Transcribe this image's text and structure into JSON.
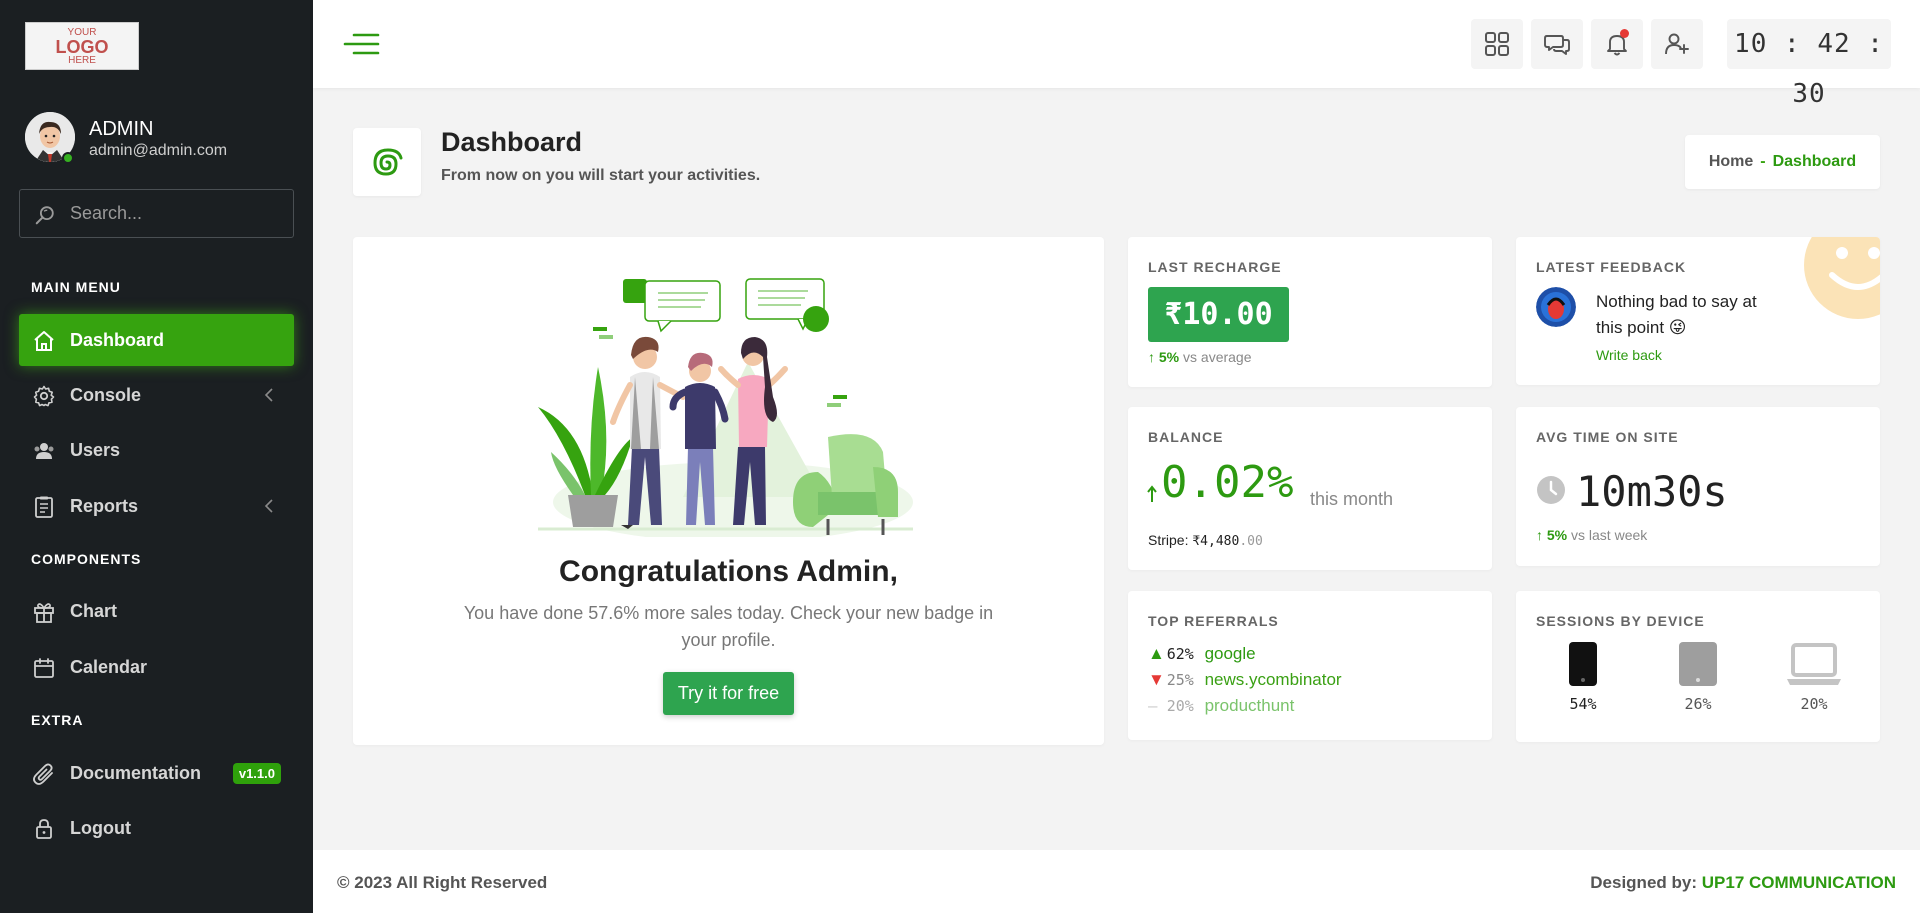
{
  "sidebar": {
    "logo": {
      "line1": "YOUR",
      "line2": "LOGO",
      "line3": "HERE"
    },
    "profile": {
      "name": "ADMIN",
      "email": "admin@admin.com",
      "status_color": "#36b021"
    },
    "search": {
      "placeholder": "Search..."
    },
    "sections": {
      "main": "MAIN MENU",
      "components": "COMPONENTS",
      "extra": "EXTRA"
    },
    "items": [
      {
        "label": "Dashboard",
        "icon": "home-icon",
        "active": true
      },
      {
        "label": "Console",
        "icon": "gear-icon",
        "has_submenu": true
      },
      {
        "label": "Users",
        "icon": "users-icon"
      },
      {
        "label": "Reports",
        "icon": "report-icon",
        "has_submenu": true
      },
      {
        "label": "Chart",
        "icon": "gift-icon"
      },
      {
        "label": "Calendar",
        "icon": "calendar-icon"
      },
      {
        "label": "Documentation",
        "icon": "paperclip-icon",
        "badge": "v1.1.0"
      },
      {
        "label": "Logout",
        "icon": "lock-icon"
      }
    ]
  },
  "header": {
    "buttons": [
      "grid-icon",
      "chat-icon",
      "bell-icon",
      "add-user-icon"
    ],
    "clock": "10 : 42 : 30"
  },
  "page": {
    "title": "Dashboard",
    "subtitle": "From now on you will start your activities.",
    "breadcrumb": {
      "home": "Home",
      "separator": "-",
      "current": "Dashboard"
    }
  },
  "congrats": {
    "title": "Congratulations Admin,",
    "text": "You have done 57.6% more sales today. Check your new badge in your profile.",
    "button": "Try it for free"
  },
  "recharge": {
    "title": "LAST RECHARGE",
    "value": "₹10.00",
    "delta": "5%",
    "delta_text": "vs average"
  },
  "feedback": {
    "title": "LATEST FEEDBACK",
    "message": "Nothing bad to say at this point 😜",
    "link": "Write back"
  },
  "balance": {
    "title": "BALANCE",
    "value": "0.02%",
    "period": "this month",
    "stripe_label": "Stripe:",
    "stripe_amount": "₹4,480",
    "stripe_cents": ".00"
  },
  "avg_time": {
    "title": "AVG TIME ON SITE",
    "value": "10m30s",
    "delta": "5%",
    "delta_text": "vs last week"
  },
  "referrals": {
    "title": "TOP REFERRALS",
    "items": [
      {
        "trend": "up",
        "marker": "▲",
        "pct": "62%",
        "name": "google"
      },
      {
        "trend": "down",
        "marker": "▼",
        "pct": "25%",
        "name": "news.ycombinator"
      },
      {
        "trend": "flat",
        "marker": "–",
        "pct": "20%",
        "name": "producthunt"
      }
    ]
  },
  "sessions": {
    "title": "SESSIONS BY DEVICE",
    "devices": [
      {
        "name": "phone",
        "icon": "phone-icon",
        "pct": "54%"
      },
      {
        "name": "tablet",
        "icon": "tablet-icon",
        "pct": "26%"
      },
      {
        "name": "laptop",
        "icon": "laptop-icon",
        "pct": "20%"
      }
    ]
  },
  "footer": {
    "copyright": "© 2023 All Right Reserved",
    "designed_by": "Designed by:",
    "brand": "UP17 COMMUNICATION"
  },
  "colors": {
    "accent": "#36a30f",
    "sidebar_bg": "#1b1f22",
    "button_green": "#2ea44f",
    "alert_red": "#e53935"
  }
}
